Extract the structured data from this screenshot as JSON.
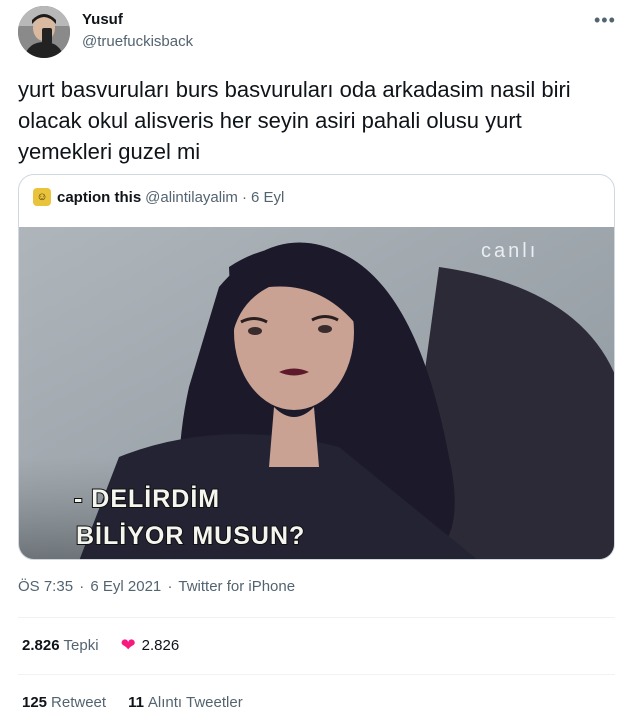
{
  "author": {
    "name": "Yusuf",
    "handle": "@truefuckisback"
  },
  "more_icon": "more-horizontal-icon",
  "tweet_text": "yurt basvuruları burs basvuruları oda arkadasim nasil biri olacak okul alisveris her seyin asiri pahali olusu yurt yemekleri guzel mi",
  "quote": {
    "name": "caption this",
    "handle": "@alintilayalim",
    "separator": "·",
    "date": "6 Eyl",
    "image": {
      "channel_logo": "canlı",
      "caption_line1": "- DELİRDİM",
      "caption_line2": "BİLİYOR MUSUN?"
    }
  },
  "meta": {
    "time": "ÖS 7:35",
    "sep1": "·",
    "date": "6 Eyl 2021",
    "sep2": "·",
    "source": "Twitter for iPhone"
  },
  "reactions": {
    "count": "2.826",
    "label": "Tepki",
    "heart_count": "2.826"
  },
  "retweets": {
    "retweet_count": "125",
    "retweet_label": "Retweet",
    "quote_count": "11",
    "quote_label": "Alıntı Tweetler"
  },
  "colors": {
    "heart": "#f91880",
    "secondary_text": "#536471",
    "border": "#cfd9de"
  }
}
